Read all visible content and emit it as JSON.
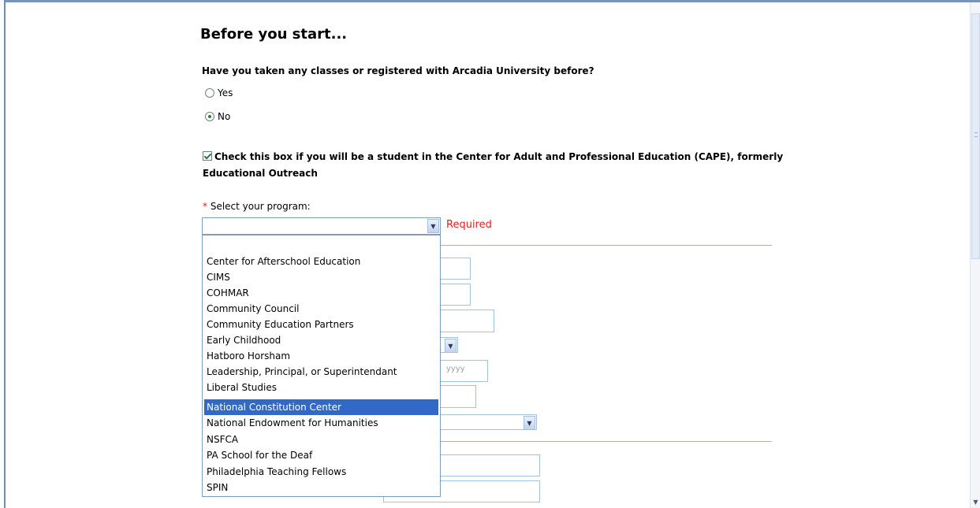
{
  "page": {
    "title": "Before you start...",
    "question": "Have you taken any classes or registered with Arcadia University before?",
    "radio_options": [
      {
        "label": "Yes",
        "checked": false
      },
      {
        "label": "No",
        "checked": true
      }
    ],
    "cape_checkbox": {
      "checked": true,
      "label": "Check this box if you will be a student in the Center for Adult and Professional Education (CAPE), formerly Educational Outreach"
    },
    "program": {
      "required_marker": "*",
      "label": "Select your program:",
      "selected_value": "",
      "required_message": "Required",
      "options": [
        "",
        "Center for Afterschool Education",
        "CIMS",
        "COHMAR",
        "Community Council",
        "Community Education Partners",
        "Early Childhood",
        "Hatboro Horsham",
        "Leadership, Principal, or Superintendant",
        "Liberal Studies",
        "National Constitution Center",
        "National Endowment for Humanities",
        "NSFCA",
        "PA School for the Deaf",
        "Philadelphia Teaching Fellows",
        "SPIN"
      ],
      "highlighted_option": "National Constitution Center"
    },
    "background_fields": {
      "year_placeholder": "yyyy"
    }
  },
  "icons": {
    "dropdown_arrow": "chevron-down-icon",
    "scroll_down": "arrow-down-icon"
  },
  "colors": {
    "required": "#e02020",
    "highlight": "#3169c6",
    "input_border": "#7f9db9"
  }
}
